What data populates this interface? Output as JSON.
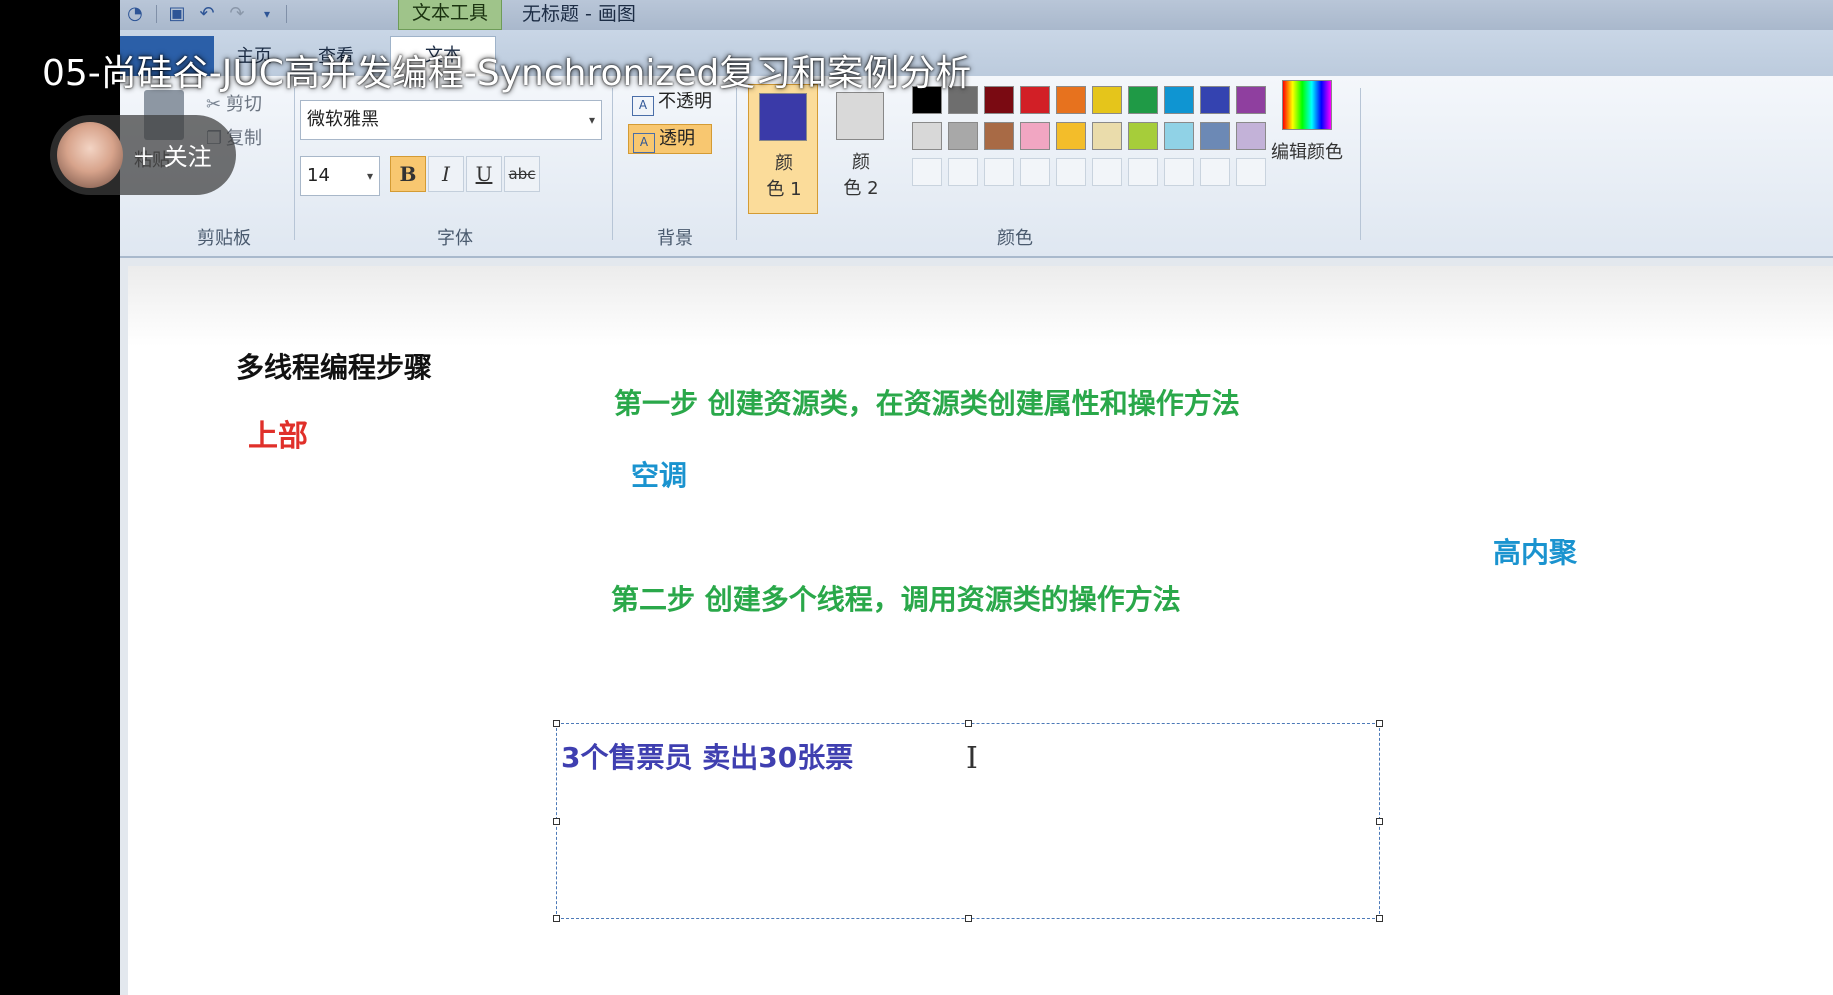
{
  "overlay": {
    "video_title": "05-尚硅谷-JUC高并发编程-Synchronized复习和案例分析",
    "follow_label": "＋ 关注"
  },
  "window": {
    "context_tab": "文本工具",
    "title": "无标题 - 画图"
  },
  "ribbon_tabs": {
    "file": "",
    "home": "主页",
    "view": "查看",
    "text": "文本"
  },
  "clipboard": {
    "paste": "粘贴",
    "cut": "剪切",
    "copy": "复制",
    "group_label": "剪贴板"
  },
  "font": {
    "family": "微软雅黑",
    "size": "14",
    "bold": "B",
    "italic": "I",
    "underline": "U",
    "strike": "abc",
    "group_label": "字体"
  },
  "background": {
    "opaque": "不透明",
    "transparent": "透明",
    "group_label": "背景"
  },
  "colors": {
    "color1_label_a": "颜",
    "color1_label_b": "色 1",
    "color2_label_a": "颜",
    "color2_label_b": "色 2",
    "color1_value": "#3a3aa8",
    "color2_value": "#d9d9d9",
    "edit_label": "编辑颜色",
    "group_label": "颜色",
    "palette_row1": [
      "#000000",
      "#6e6e6e",
      "#7a0a12",
      "#d21f26",
      "#e7721e",
      "#e5c51b",
      "#1f9a46",
      "#0f95d2",
      "#3443b0",
      "#8f3f9f"
    ],
    "palette_row2": [
      "#d8d8d8",
      "#a8a8a8",
      "#a86a45",
      "#f1a6c2",
      "#f3bd2a",
      "#eadcab",
      "#a6cd3a",
      "#90d2e6",
      "#6c89b5",
      "#c3b2d8"
    ]
  },
  "canvas": {
    "heading": "多线程编程步骤",
    "top_label": "上部",
    "step1": "第一步  创建资源类，在资源类创建属性和操作方法",
    "aircon": "空调",
    "cohesion": "高内聚",
    "step2": "第二步  创建多个线程，调用资源类的操作方法",
    "editing_text": "3个售票员    卖出30张票",
    "text_colors": {
      "heading": "#111111",
      "top_label": "#e0302a",
      "steps": "#2aa84a",
      "blue": "#1a93cf",
      "editing": "#3f3fb0"
    }
  }
}
